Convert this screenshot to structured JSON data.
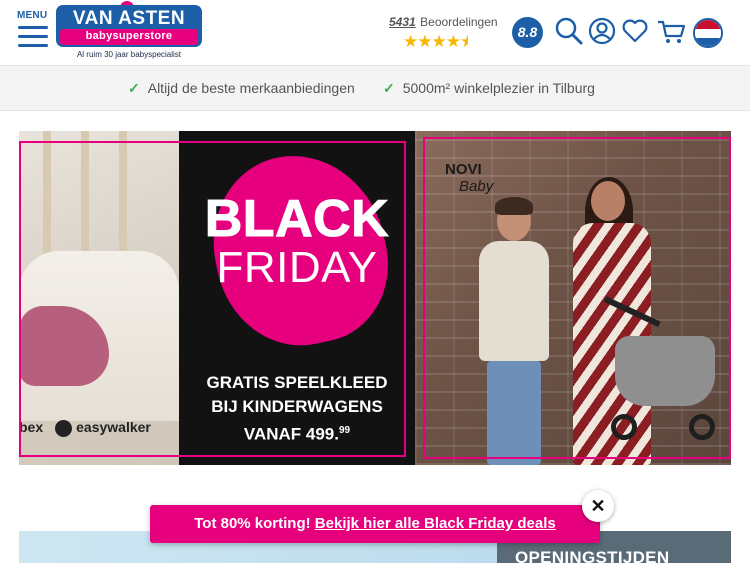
{
  "header": {
    "menu_label": "MENU",
    "logo": {
      "brand": "VAN ASTEN",
      "sub": "babysuperstore",
      "tagline": "Al ruim 30 jaar babyspecialist"
    },
    "reviews": {
      "count": "5431",
      "label": "Beoordelingen",
      "stars": 4.5,
      "score": "8.8"
    },
    "icons": [
      "search-icon",
      "account-icon",
      "wishlist-heart-icon",
      "cart-icon",
      "language-flag-nl"
    ]
  },
  "usp_bar": {
    "items": [
      "Altijd de beste merkaanbiedingen",
      "5000m² winkelplezier in Tilburg"
    ]
  },
  "banner": {
    "left_brands": [
      "bex",
      "easywalker"
    ],
    "black_friday": {
      "line1": "BLACK",
      "line2": "FRIDAY",
      "promo_line1": "GRATIS SPEELKLEED",
      "promo_line2": "BIJ KINDERWAGENS",
      "promo_price": "VANAF 499.",
      "promo_cents": "99"
    },
    "right_brand": {
      "line1": "NOVI",
      "line2": "Baby"
    },
    "accent_color": "#e6007e"
  },
  "lower": {
    "hours_title": "OPENINGSTIJDEN"
  },
  "promo_bar": {
    "text": "Tot 80% korting!",
    "link_text": "Bekijk hier alle Black Friday deals",
    "close_symbol": "✕"
  },
  "colors": {
    "brand_blue": "#1c5fa8",
    "brand_pink": "#e6007e",
    "check_green": "#3caf4d"
  }
}
